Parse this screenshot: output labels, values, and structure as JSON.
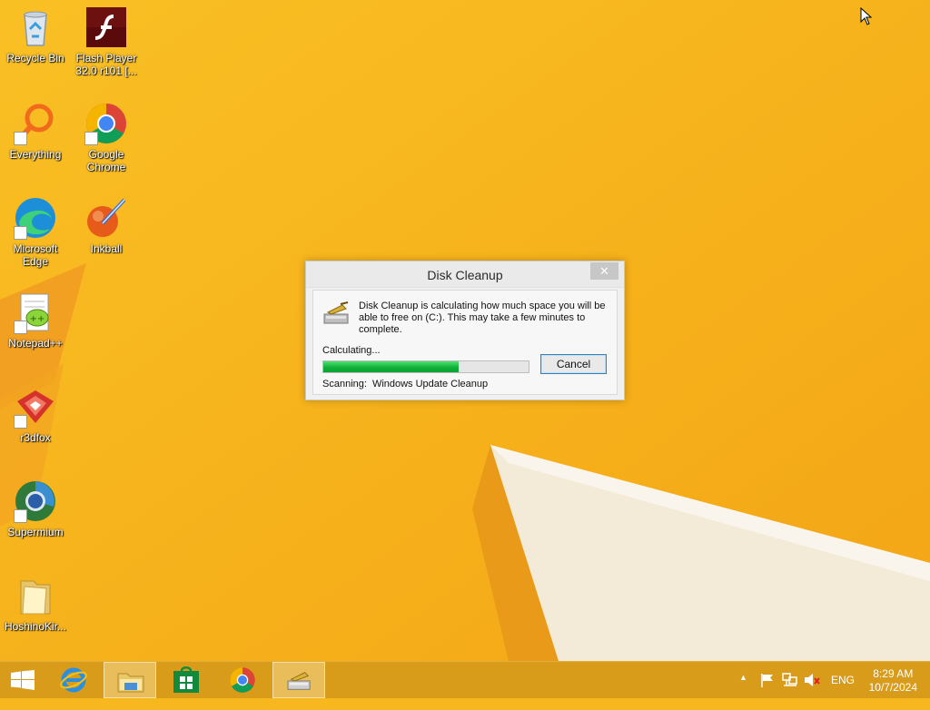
{
  "desktop": {
    "icons": [
      {
        "label": "Recycle Bin",
        "icon": "recycle-bin-icon"
      },
      {
        "label": "Flash Player 32.0 r101 [...",
        "icon": "flash-player-icon"
      },
      {
        "label": "Everything",
        "icon": "everything-icon"
      },
      {
        "label": "Google Chrome",
        "icon": "chrome-icon"
      },
      {
        "label": "Microsoft Edge",
        "icon": "edge-icon"
      },
      {
        "label": "Inkball",
        "icon": "inkball-icon"
      },
      {
        "label": "Notepad++",
        "icon": "notepad-plus-plus-icon"
      },
      {
        "label": "r3dfox",
        "icon": "r3dfox-icon"
      },
      {
        "label": "Supermium",
        "icon": "supermium-icon"
      },
      {
        "label": "HoshinoKir...",
        "icon": "folder-icon"
      }
    ]
  },
  "dialog": {
    "title": "Disk Cleanup",
    "close_glyph": "✕",
    "message": "Disk Cleanup is calculating how much space you will be able to free on  (C:). This may take a few minutes to complete.",
    "status": "Calculating...",
    "progress": 0.66,
    "cancel_label": "Cancel",
    "scanning_label": "Scanning:",
    "scanning_value": "Windows Update Cleanup"
  },
  "taskbar": {
    "items": [
      "start-icon",
      "internet-explorer-icon",
      "file-explorer-icon",
      "store-icon",
      "chrome-icon",
      "disk-cleanup-icon"
    ],
    "tray": {
      "show_hidden_glyph": "▲",
      "language": "ENG"
    },
    "clock": {
      "time": "8:29 AM",
      "date": "10/7/2024"
    }
  },
  "colors": {
    "wallpaper_yellow": "#f7b81f",
    "wallpaper_orange": "#f08a1c",
    "progress_green": "#11b03a"
  }
}
